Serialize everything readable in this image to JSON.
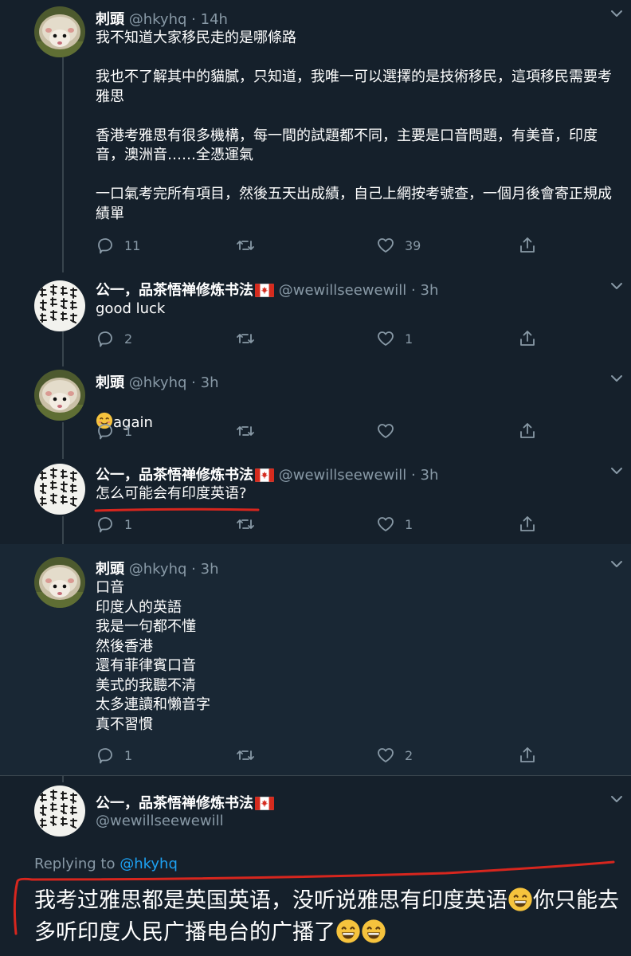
{
  "colors": {
    "background": "#15202b",
    "highlight_background": "#192734",
    "text": "#ffffff",
    "muted": "#8899a6",
    "link": "#1da1f2",
    "annotation_red": "#d7261e"
  },
  "tweets": [
    {
      "name": "刺頭",
      "handle": "@hkyhq",
      "dot": "·",
      "time": "14h",
      "avatar": "hedgehog",
      "body": "我不知道大家移民走的是哪條路\n\n我也不了解其中的貓膩，只知道，我唯一可以選擇的是技術移民，這項移民需要考雅思\n\n香港考雅思有很多機構，每一間的試題都不同，主要是口音問題，有美音，印度音，澳洲音……全憑運氣\n\n一口氣考完所有項目，然後五天出成績，自己上網按考號查，一個月後會寄正規成績單",
      "replies": "11",
      "retweets": "",
      "likes": "39"
    },
    {
      "name": "公一，品茶悟禅修炼书法",
      "handle": "@wewillseewewill",
      "dot": "·",
      "time": "3h",
      "avatar": "calligraphy",
      "flag": "canada-flag",
      "body": "good luck",
      "replies": "2",
      "retweets": "",
      "likes": "1"
    },
    {
      "name": "刺頭",
      "handle": "@hkyhq",
      "dot": "·",
      "time": "3h",
      "avatar": "hedgehog",
      "body_emoji": "smiling-face-emoji",
      "body": "again",
      "replies": "1",
      "retweets": "",
      "likes": ""
    },
    {
      "name": "公一，品茶悟禅修炼书法",
      "handle": "@wewillseewewill",
      "dot": "·",
      "time": "3h",
      "avatar": "calligraphy",
      "flag": "canada-flag",
      "body": "怎么可能会有印度英语?",
      "replies": "1",
      "retweets": "",
      "likes": "1"
    },
    {
      "name": "刺頭",
      "handle": "@hkyhq",
      "dot": "·",
      "time": "3h",
      "avatar": "hedgehog",
      "body": "口音\n印度人的英語\n我是一句都不懂\n然後香港\n還有菲律賓口音\n美式的我聽不清\n太多連讀和懶音字\n真不習慣",
      "replies": "1",
      "retweets": "",
      "likes": "2"
    }
  ],
  "main_tweet": {
    "name": "公一，品茶悟禅修炼书法",
    "handle": "@wewillseewewill",
    "flag": "canada-flag",
    "replying_to_label": "Replying to",
    "replying_to_handle": "@hkyhq",
    "text_part1": "我考过雅思都是英国英语，没听说雅思有印度英语",
    "text_part2": "你只能去多听印度人民广播电台的广播了",
    "emoji": "grinning-face-emoji"
  }
}
